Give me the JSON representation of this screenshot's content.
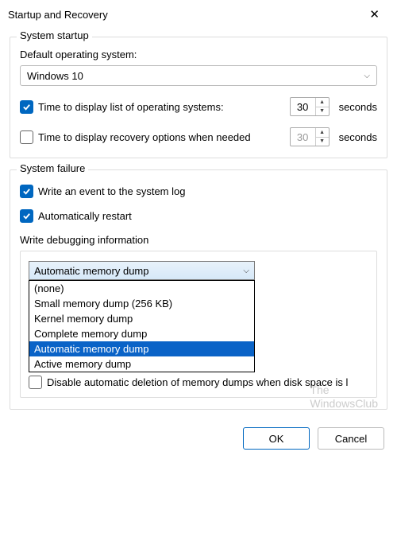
{
  "window": {
    "title": "Startup and Recovery"
  },
  "startup": {
    "legend": "System startup",
    "default_os_label": "Default operating system:",
    "default_os_value": "Windows 10",
    "time_list_label": "Time to display list of operating systems:",
    "time_list_value": "30",
    "time_recovery_label": "Time to display recovery options when needed",
    "time_recovery_value": "30",
    "seconds_label": "seconds"
  },
  "failure": {
    "legend": "System failure",
    "write_event_label": "Write an event to the system log",
    "auto_restart_label": "Automatically restart",
    "write_debug_label": "Write debugging information",
    "dropdown_selected": "Automatic memory dump",
    "dropdown_options": {
      "0": "(none)",
      "1": "Small memory dump (256 KB)",
      "2": "Kernel memory dump",
      "3": "Complete memory dump",
      "4": "Automatic memory dump",
      "5": "Active memory dump"
    },
    "disable_auto_delete_label": "Disable automatic deletion of memory dumps when disk space is l"
  },
  "footer": {
    "ok": "OK",
    "cancel": "Cancel"
  },
  "watermark": {
    "line1": "The",
    "line2": "WindowsClub"
  }
}
